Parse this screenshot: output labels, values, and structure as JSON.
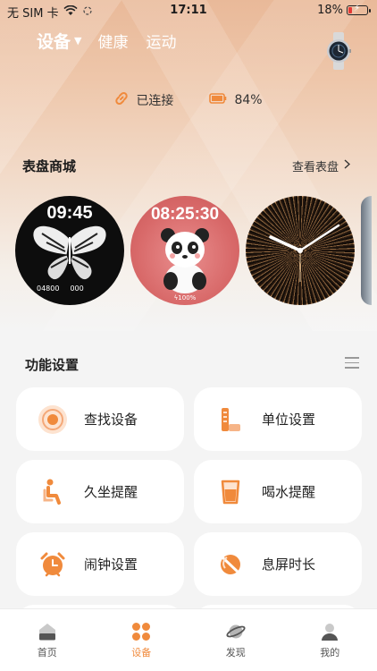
{
  "status_bar": {
    "carrier": "无 SIM 卡",
    "time": "17:11",
    "battery": "18%"
  },
  "top_nav": {
    "tabs": [
      "设备",
      "健康",
      "运动"
    ],
    "active": "设备"
  },
  "connection": {
    "status": "已连接",
    "battery": "84%"
  },
  "dial_store": {
    "title": "表盘商城",
    "view_all": "查看表盘",
    "dials": [
      {
        "time": "09:45",
        "steps": "04800",
        "heart": "000"
      },
      {
        "time": "08:25:30",
        "battery": "100%"
      },
      {},
      {}
    ]
  },
  "functions": {
    "title": "功能设置",
    "items": [
      {
        "label": "查找设备",
        "icon": "find-device-icon"
      },
      {
        "label": "单位设置",
        "icon": "unit-settings-icon"
      },
      {
        "label": "久坐提醒",
        "icon": "sedentary-reminder-icon"
      },
      {
        "label": "喝水提醒",
        "icon": "drink-water-icon"
      },
      {
        "label": "闹钟设置",
        "icon": "alarm-clock-icon"
      },
      {
        "label": "息屏时长",
        "icon": "screen-off-icon"
      }
    ]
  },
  "tab_bar": {
    "items": [
      {
        "label": "首页",
        "icon": "home-icon"
      },
      {
        "label": "设备",
        "icon": "device-icon"
      },
      {
        "label": "发现",
        "icon": "discover-icon"
      },
      {
        "label": "我的",
        "icon": "profile-icon"
      }
    ],
    "active": "设备"
  },
  "colors": {
    "accent": "#f08a3c",
    "tile_bg": "#ffffff",
    "page_bg": "#f4f4f4"
  }
}
